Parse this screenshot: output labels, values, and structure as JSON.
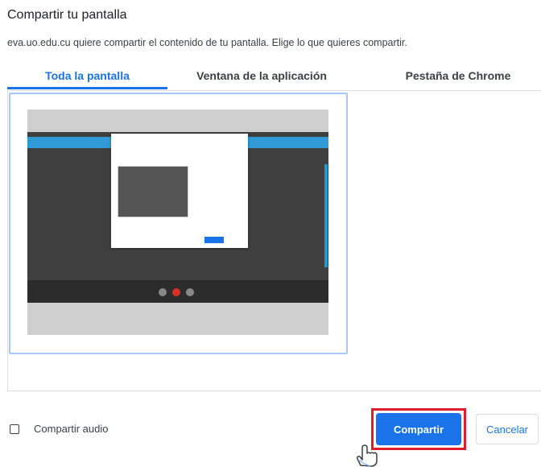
{
  "dialog": {
    "title": "Compartir tu pantalla",
    "subtitle": "eva.uo.edu.cu quiere compartir el contenido de tu pantalla. Elige lo que quieres compartir."
  },
  "tabs": [
    {
      "label": "Toda la pantalla",
      "active": true
    },
    {
      "label": "Ventana de la aplicación",
      "active": false
    },
    {
      "label": "Pestaña de Chrome",
      "active": false
    }
  ],
  "audio": {
    "label": "Compartir audio",
    "checked": false
  },
  "buttons": {
    "share": "Compartir",
    "cancel": "Cancelar"
  },
  "colors": {
    "accent": "#1a73e8",
    "highlight": "#e01e2b"
  },
  "icons": {
    "cursor": "hand-pointer-icon"
  }
}
